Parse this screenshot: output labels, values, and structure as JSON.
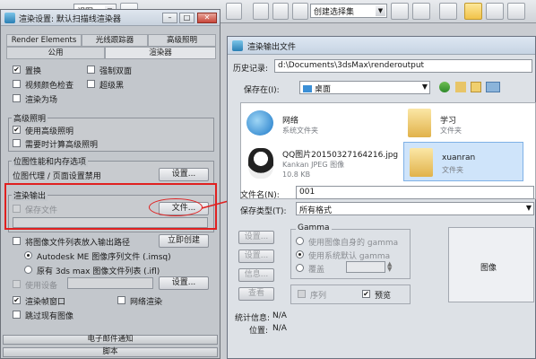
{
  "toolbar": {
    "view_combo": "视图",
    "selection_set_combo": "创建选择集"
  },
  "render_settings": {
    "title": "渲染设置: 默认扫描线渲染器",
    "tabs_row1": [
      "Render Elements",
      "光线跟踪器",
      "高级照明"
    ],
    "tabs_row2": [
      "公用",
      "渲染器"
    ],
    "options": {
      "displacement": "置换",
      "force_two_sided": "强制双面",
      "video_color_check": "视频颜色检查",
      "super_black": "超级黑",
      "render_to_fields": "渲染为场"
    },
    "advanced_lighting": {
      "group_title": "高级照明",
      "use": "使用高级照明",
      "compute_when_required": "需要时计算高级照明"
    },
    "bitmap": {
      "group_title": "位图性能和内存选项",
      "proxy_status": "位图代理 / 页面设置禁用",
      "setup_button": "设置..."
    },
    "render_output": {
      "group_title": "渲染输出",
      "save_file": "保存文件",
      "files_button": "文件..."
    },
    "put_image_list": "将图像文件列表放入输出路径",
    "create_now_button": "立即创建",
    "me_sequence": "Autodesk ME 图像序列文件 (.imsq)",
    "legacy_ifl": "原有 3ds max 图像文件列表 (.ifl)",
    "use_device": "使用设备",
    "device_setup_button": "设置...",
    "rendered_frame_window": "渲染帧窗口",
    "net_render": "网络渲染",
    "skip_existing": "跳过现有图像",
    "rollout_email": "电子邮件通知",
    "rollout_script": "脚本"
  },
  "file_dialog": {
    "title": "渲染输出文件",
    "history_label": "历史记录:",
    "history_path": "d:\\Documents\\3dsMax\\renderoutput",
    "save_in_label": "保存在(I):",
    "save_in_value": "桌面",
    "files": [
      {
        "name": "网络",
        "sub": "系统文件夹"
      },
      {
        "name": "学习",
        "sub": "文件夹"
      },
      {
        "name": "QQ图片20150327164216.jpg",
        "sub": "Kankan JPEG 图像",
        "sub2": "10.8 KB"
      },
      {
        "name": "xuanran",
        "sub": "文件夹"
      }
    ],
    "filename_label": "文件名(N):",
    "filename_value": "001",
    "save_type_label": "保存类型(T):",
    "save_type_value": "所有格式",
    "buttons": {
      "setup": "设置...",
      "info": "信息...",
      "view": "查看"
    },
    "gamma": {
      "title": "Gamma",
      "own": "使用图像自身的 gamma",
      "system": "使用系统默认 gamma",
      "override": "覆盖"
    },
    "sequence": "序列",
    "preview": "预览",
    "image_label": "图像",
    "stats_label": "统计信息:",
    "stats_value": "N/A",
    "location_label": "位置:",
    "location_value": "N/A"
  },
  "colors": {
    "annotation_red": "#e02020",
    "selection_blue": "#cfe4fa"
  }
}
